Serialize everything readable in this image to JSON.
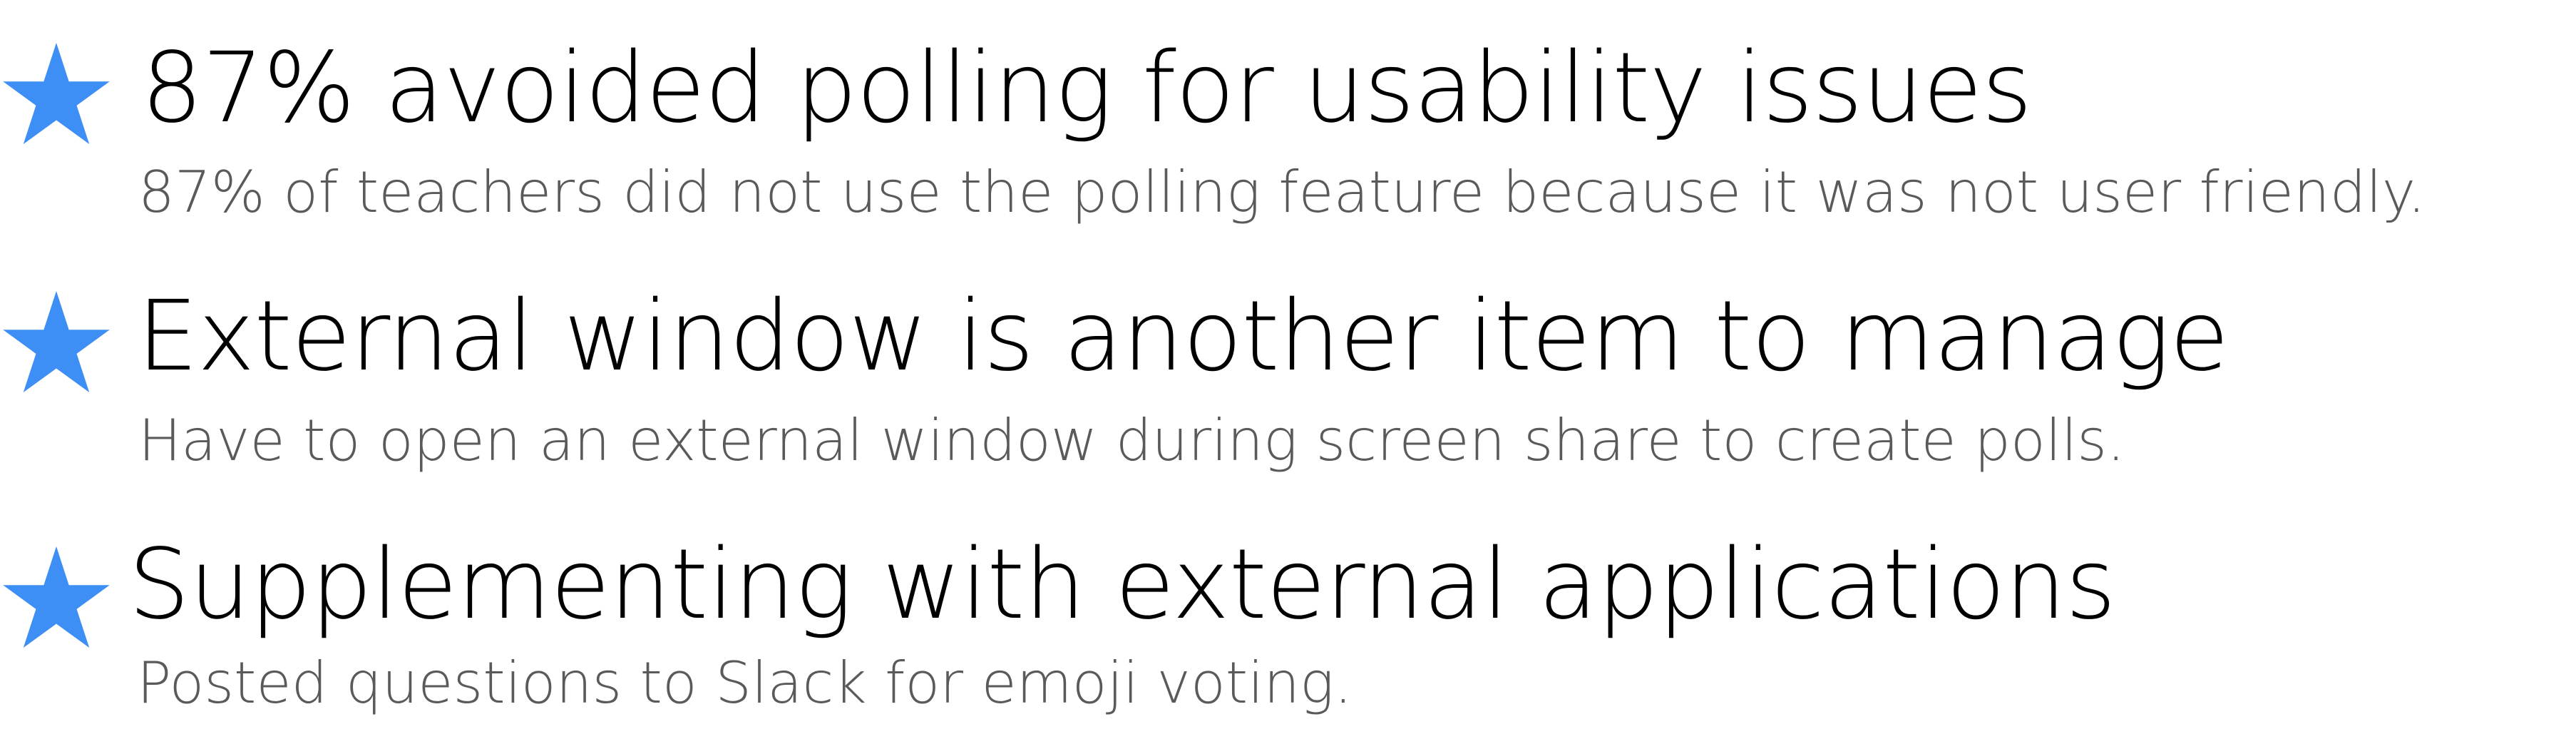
{
  "colors": {
    "star": "#3d8ef5",
    "title": "#000000",
    "description": "#5a5a5a"
  },
  "items": [
    {
      "icon": "star-icon",
      "title": "87% avoided polling for usability issues",
      "description": "87% of teachers did not use the polling feature because it was not user friendly."
    },
    {
      "icon": "star-icon",
      "title": "External window is another item to manage",
      "description": "Have to open an external window during screen share to create polls."
    },
    {
      "icon": "star-icon",
      "title": "Supplementing with external applications",
      "description": "Posted questions to Slack for emoji voting."
    }
  ]
}
